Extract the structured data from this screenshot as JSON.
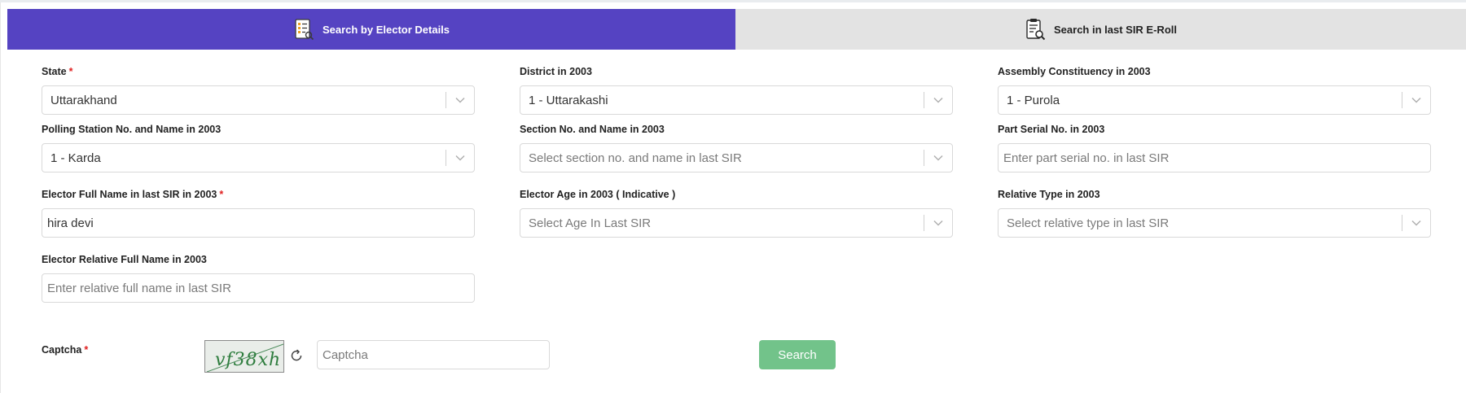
{
  "tabs": {
    "elector_details": "Search by Elector Details",
    "last_sir_eroll": "Search in last SIR E-Roll"
  },
  "form": {
    "state": {
      "label": "State",
      "required": "*",
      "value": "Uttarakhand"
    },
    "district": {
      "label": "District in 2003",
      "value": "1 - Uttarakashi"
    },
    "assembly": {
      "label": "Assembly Constituency in 2003",
      "value": "1 - Purola"
    },
    "polling_station": {
      "label": "Polling Station No. and Name in 2003",
      "value": "1 - Karda"
    },
    "section": {
      "label": "Section No. and Name in 2003",
      "placeholder": "Select section no. and name in last SIR"
    },
    "part_serial": {
      "label": "Part Serial No. in 2003",
      "placeholder": "Enter part serial no. in last SIR"
    },
    "elector_name": {
      "label": "Elector Full Name in last SIR in 2003",
      "required": "*",
      "value": "hira devi"
    },
    "elector_age": {
      "label": "Elector Age in 2003 ( Indicative )",
      "placeholder": "Select Age In Last SIR"
    },
    "relative_type": {
      "label": "Relative Type in 2003",
      "placeholder": "Select relative type in last SIR"
    },
    "relative_name": {
      "label": "Elector Relative Full Name in 2003",
      "placeholder": "Enter relative full name in last SIR"
    }
  },
  "captcha": {
    "label": "Captcha",
    "required": "*",
    "image_text": "vf38xh",
    "placeholder": "Captcha"
  },
  "search_button": "Search",
  "colors": {
    "active_tab": "#5543c2",
    "inactive_tab": "#e3e3e3",
    "search_button": "#72c38a",
    "required_mark": "#e02020"
  }
}
